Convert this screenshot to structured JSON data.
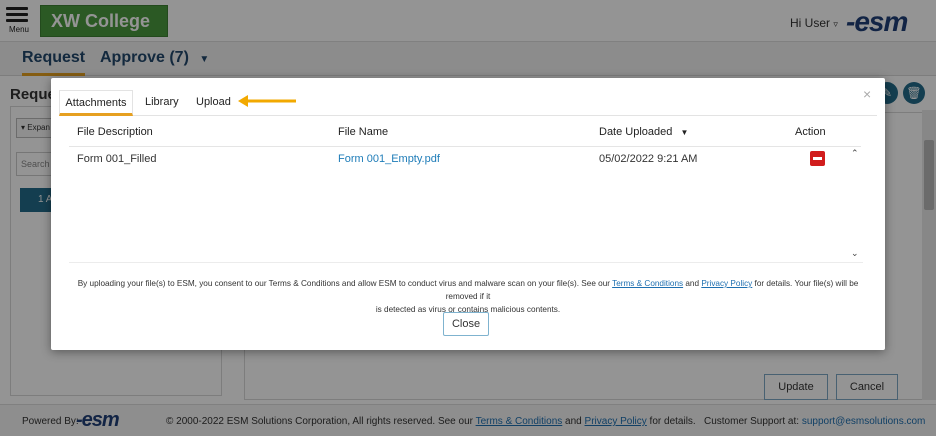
{
  "header": {
    "menu_label": "Menu",
    "college_name": "XW College",
    "user_greeting": "Hi User",
    "brand_logo": "esm"
  },
  "nav": {
    "tabs": [
      {
        "label": "Request",
        "active": true
      },
      {
        "label": "Approve (7)",
        "active": false
      }
    ]
  },
  "page": {
    "title": "Reques",
    "expand_label": "Expan",
    "search_placeholder": "Search",
    "blue_button_label": "1 A",
    "update_label": "Update",
    "cancel_label": "Cancel"
  },
  "modal": {
    "tabs": [
      {
        "label": "Attachments",
        "active": true
      },
      {
        "label": "Library",
        "active": false
      },
      {
        "label": "Upload",
        "active": false
      }
    ],
    "close_symbol": "×",
    "columns": {
      "file_description": "File Description",
      "file_name": "File Name",
      "date_uploaded": "Date Uploaded",
      "action": "Action"
    },
    "rows": [
      {
        "file_description": "Form 001_Filled",
        "file_name": "Form 001_Empty.pdf",
        "date_uploaded": "05/02/2022 9:21 AM"
      }
    ],
    "consent": {
      "part1": "By uploading your file(s) to ESM, you consent to our Terms & Conditions and allow ESM to conduct virus and malware scan on your file(s). See our ",
      "terms_link": "Terms & Conditions",
      "and": " and ",
      "privacy_link": "Privacy Policy",
      "part2": " for details. Your file(s) will be removed if it",
      "line2": "is detected as virus or contains malicious contents."
    },
    "close_button_label": "Close"
  },
  "footer": {
    "powered_by": "Powered By:",
    "brand_logo": "esm",
    "copyright_prefix": "© 2000-2022 ESM Solutions Corporation, All rights reserved. See our ",
    "terms_link": "Terms & Conditions",
    "and": " and ",
    "privacy_link": "Privacy Policy",
    "copyright_suffix": " for details.",
    "support_label": "Customer Support at: ",
    "support_email": "support@esmsolutions.com"
  },
  "colors": {
    "accent": "#e6a020",
    "brand_green": "#4a9a3e",
    "brand_blue": "#1f3f77",
    "link": "#1e7cb8",
    "danger": "#d11d1d"
  },
  "icons": [
    "hamburger-menu-icon",
    "chevron-down-icon",
    "sort-down-icon",
    "remove-icon",
    "scroll-up-icon",
    "scroll-down-icon",
    "close-icon",
    "trash-icon",
    "arrow-left-icon"
  ]
}
